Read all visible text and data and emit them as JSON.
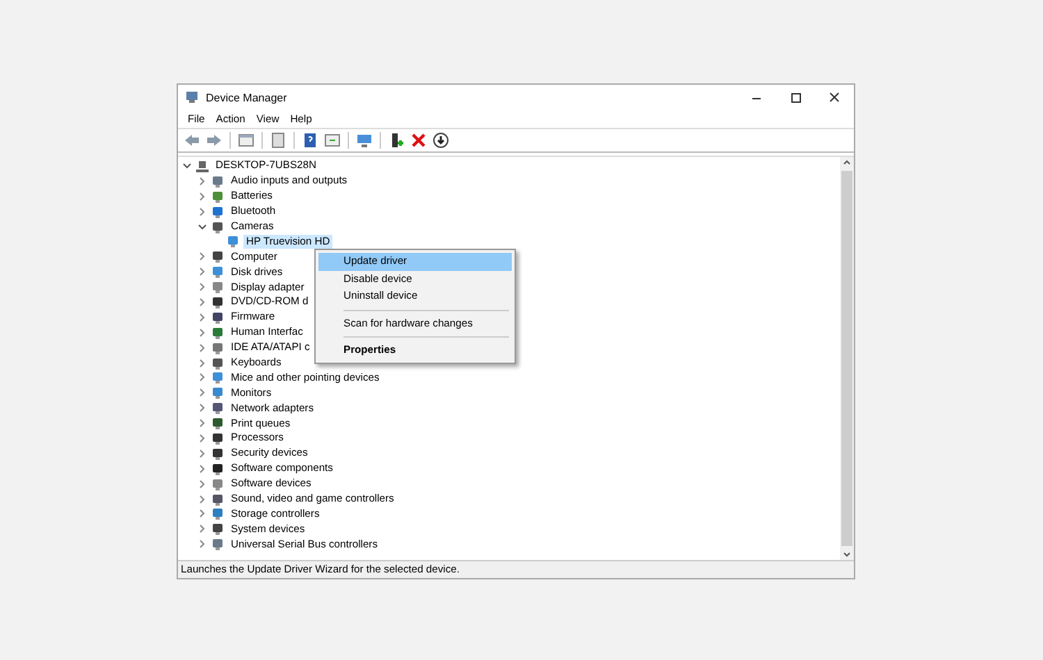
{
  "window": {
    "title": "Device Manager"
  },
  "menu": [
    "File",
    "Action",
    "View",
    "Help"
  ],
  "tree": {
    "label": "DESKTOP-7UBS28N",
    "expanded": true,
    "selected": false,
    "children": [
      {
        "label": "Audio inputs and outputs",
        "expanded": false,
        "selected": false
      },
      {
        "label": "Batteries",
        "expanded": false,
        "selected": false
      },
      {
        "label": "Bluetooth",
        "expanded": false,
        "selected": false
      },
      {
        "label": "Cameras",
        "expanded": true,
        "selected": false,
        "children": [
          {
            "label": "HP Truevision HD",
            "selected": true
          }
        ]
      },
      {
        "label": "Computer",
        "expanded": false,
        "selected": false
      },
      {
        "label": "Disk drives",
        "expanded": false,
        "selected": false
      },
      {
        "label": "Display adapter",
        "expanded": false,
        "selected": false
      },
      {
        "label": "DVD/CD-ROM d",
        "expanded": false,
        "selected": false
      },
      {
        "label": "Firmware",
        "expanded": false,
        "selected": false
      },
      {
        "label": "Human Interfac",
        "expanded": false,
        "selected": false
      },
      {
        "label": "IDE ATA/ATAPI c",
        "expanded": false,
        "selected": false
      },
      {
        "label": "Keyboards",
        "expanded": false,
        "selected": false
      },
      {
        "label": "Mice and other pointing devices",
        "expanded": false,
        "selected": false
      },
      {
        "label": "Monitors",
        "expanded": false,
        "selected": false
      },
      {
        "label": "Network adapters",
        "expanded": false,
        "selected": false
      },
      {
        "label": "Print queues",
        "expanded": false,
        "selected": false
      },
      {
        "label": "Processors",
        "expanded": false,
        "selected": false
      },
      {
        "label": "Security devices",
        "expanded": false,
        "selected": false
      },
      {
        "label": "Software components",
        "expanded": false,
        "selected": false
      },
      {
        "label": "Software devices",
        "expanded": false,
        "selected": false
      },
      {
        "label": "Sound, video and game controllers",
        "expanded": false,
        "selected": false
      },
      {
        "label": "Storage controllers",
        "expanded": false,
        "selected": false
      },
      {
        "label": "System devices",
        "expanded": false,
        "selected": false
      },
      {
        "label": "Universal Serial Bus controllers",
        "expanded": false,
        "selected": false
      }
    ]
  },
  "context_menu": [
    {
      "kind": "item",
      "label": "Update driver",
      "selected": true,
      "default": false
    },
    {
      "kind": "item",
      "label": "Disable device",
      "selected": false,
      "default": false
    },
    {
      "kind": "item",
      "label": "Uninstall device",
      "selected": false,
      "default": false
    },
    {
      "kind": "separator"
    },
    {
      "kind": "item",
      "label": "Scan for hardware changes",
      "selected": false,
      "default": false
    },
    {
      "kind": "separator"
    },
    {
      "kind": "item",
      "label": "Properties",
      "selected": false,
      "default": true
    }
  ],
  "status_bar": "Launches the Update Driver Wizard for the selected device."
}
